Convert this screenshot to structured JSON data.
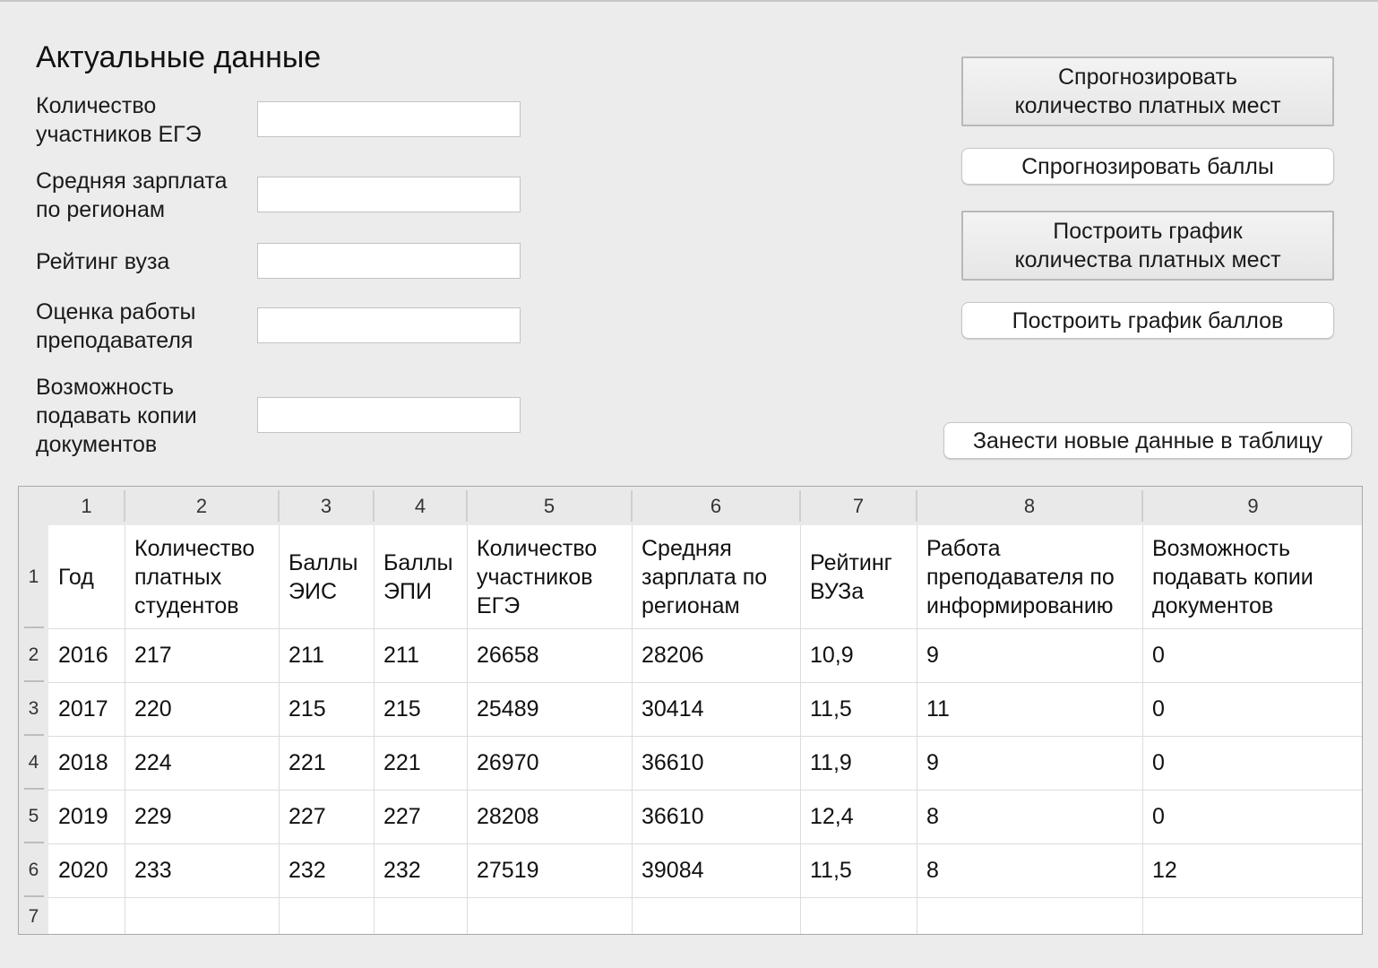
{
  "form": {
    "title": "Актуальные данные",
    "fields": [
      {
        "label_lines": [
          "Количество",
          "участников ЕГЭ"
        ],
        "value": ""
      },
      {
        "label_lines": [
          "Средняя зарплата",
          "по регионам"
        ],
        "value": ""
      },
      {
        "label_lines": [
          "Рейтинг вуза"
        ],
        "value": ""
      },
      {
        "label_lines": [
          "Оценка работы",
          "преподавателя"
        ],
        "value": ""
      },
      {
        "label_lines": [
          "Возможность",
          "подавать копии",
          "документов"
        ],
        "value": ""
      }
    ]
  },
  "buttons": {
    "forecast_paid_places": [
      "Спрогнозировать",
      "количество платных мест"
    ],
    "forecast_scores": "Спрогнозировать баллы",
    "plot_paid_places": [
      "Построить график",
      "количества платных мест"
    ],
    "plot_scores": "Построить график баллов",
    "add_to_table": "Занести новые данные в таблицу"
  },
  "table": {
    "column_numbers": [
      "1",
      "2",
      "3",
      "4",
      "5",
      "6",
      "7",
      "8",
      "9"
    ],
    "row_numbers": [
      "1",
      "2",
      "3",
      "4",
      "5",
      "6",
      "7"
    ],
    "header_cells": [
      [
        "Год"
      ],
      [
        "Количество",
        "платных",
        "студентов"
      ],
      [
        "Баллы",
        "ЭИС"
      ],
      [
        "Баллы",
        "ЭПИ"
      ],
      [
        "Количество",
        "участников",
        "ЕГЭ"
      ],
      [
        "Средняя",
        "зарплата по",
        "регионам"
      ],
      [
        "Рейтинг",
        "ВУЗа"
      ],
      [
        "Работа",
        "преподавателя по",
        "информированию"
      ],
      [
        "Возможность",
        "подавать копии",
        "документов"
      ]
    ],
    "rows": [
      [
        "2016",
        "217",
        "211",
        "211",
        "26658",
        "28206",
        "10,9",
        "9",
        "0"
      ],
      [
        "2017",
        "220",
        "215",
        "215",
        "25489",
        "30414",
        "11,5",
        "11",
        "0"
      ],
      [
        "2018",
        "224",
        "221",
        "221",
        "26970",
        "36610",
        "11,9",
        "9",
        "0"
      ],
      [
        "2019",
        "229",
        "227",
        "227",
        "28208",
        "36610",
        "12,4",
        "8",
        "0"
      ],
      [
        "2020",
        "233",
        "232",
        "232",
        "27519",
        "39084",
        "11,5",
        "8",
        "12"
      ],
      [
        "",
        "",
        "",
        "",
        "",
        "",
        "",
        "",
        ""
      ]
    ]
  }
}
